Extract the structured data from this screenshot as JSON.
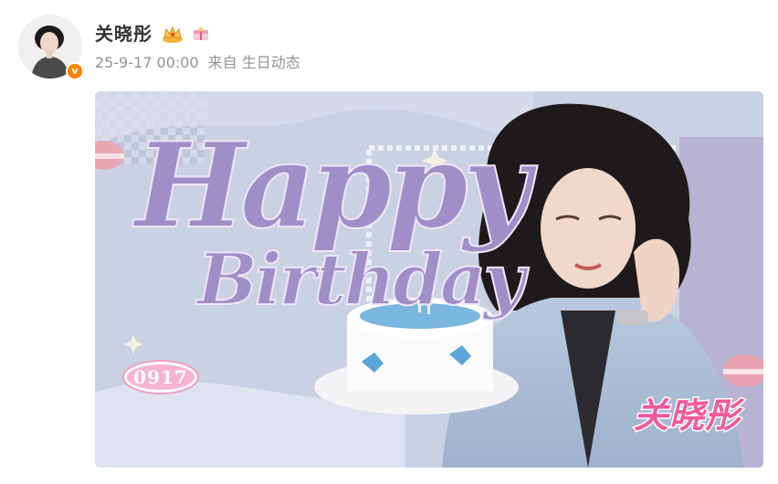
{
  "post": {
    "username": "关晓彤",
    "date": "25-9-17 00:00",
    "source_prefix": "来自",
    "source": "生日动态"
  },
  "badges": [
    "crown-icon",
    "gift-icon",
    "verified-v-icon"
  ],
  "banner": {
    "happy": "Happy",
    "birthday": "Birthday",
    "date_code": "0917",
    "name_stamp": "关晓彤"
  },
  "colors": {
    "username": "#333333",
    "meta": "#939393",
    "banner_bg": "#c9d1e3",
    "script_purple": "#9f8fc8",
    "stamp_pink": "#f05a9a",
    "verified": "#ff8200"
  }
}
